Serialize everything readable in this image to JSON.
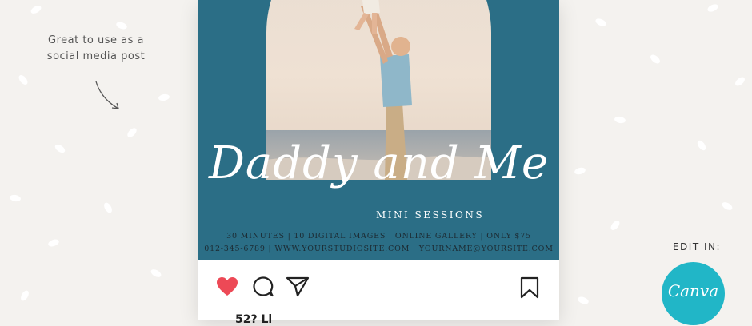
{
  "left_note": "Great to use as a\nsocial media post",
  "post": {
    "title": "Daddy and Me",
    "subtitle": "MINI SESSIONS",
    "details_line1": "30 MINUTES | 10 DIGITAL IMAGES | ONLINE GALLERY | ONLY $75",
    "details_line2": "012-345-6789 | WWW.YOURSTUDIOSITE.COM | YOURNAME@YOURSITE.COM",
    "background_color": "#2b6e86"
  },
  "actions": {
    "icons": [
      "heart-icon",
      "comment-icon",
      "send-icon",
      "bookmark-icon"
    ],
    "likes_partial": "52? Li"
  },
  "badge": {
    "label": "EDIT IN:",
    "brand": "Canva",
    "brand_color": "#21b6c7"
  },
  "colors": {
    "like": "#ed4956",
    "background": "#f4f2ef"
  }
}
